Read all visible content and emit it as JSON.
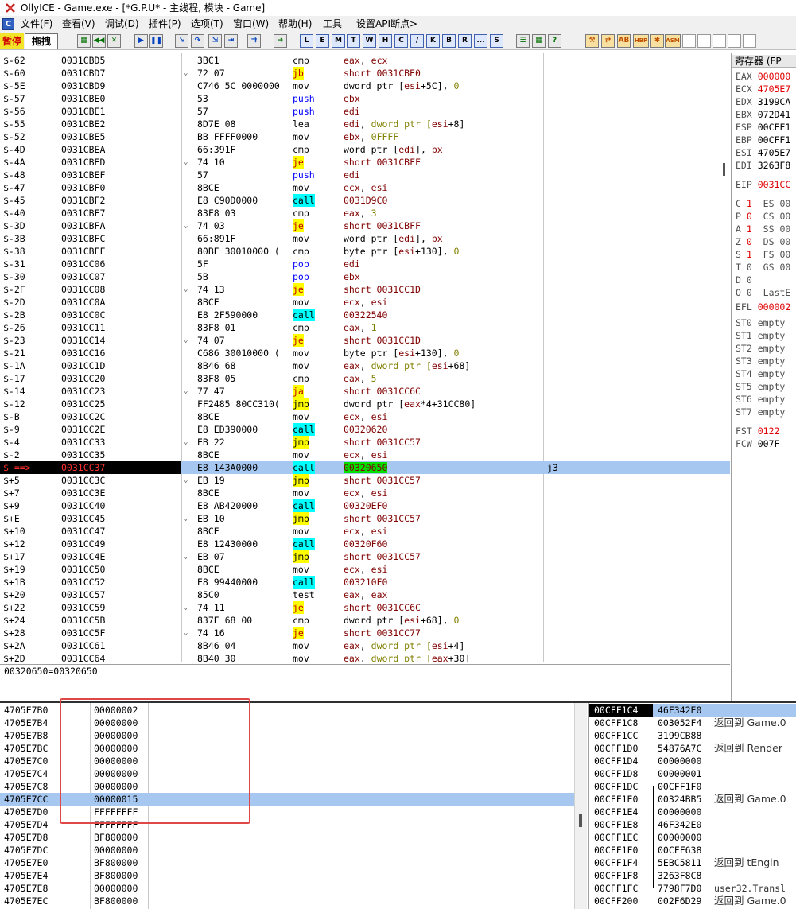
{
  "title": "OllyICE - Game.exe - [*G.P.U* - 主线程, 模块 - Game]",
  "menu": [
    "文件(F)",
    "查看(V)",
    "调试(D)",
    "插件(P)",
    "选项(T)",
    "窗口(W)",
    "帮助(H)",
    "工具",
    "设置API断点>"
  ],
  "toolbar": {
    "pause": "暂停",
    "drag": "拖拽",
    "letters": [
      "L",
      "E",
      "M",
      "T",
      "W",
      "H",
      "C",
      "/",
      "K",
      "B",
      "R",
      "...",
      "S"
    ],
    "extra": [
      "HBP",
      "ASM"
    ]
  },
  "cpu_rows": [
    {
      "label": "$-62",
      "addr": "0031CBD5",
      "hex": "3BC1",
      "mn": "cmp",
      "ops": "eax, ecx"
    },
    {
      "label": "$-60",
      "addr": "0031CBD7",
      "hex": "72 07",
      "mn": "jb",
      "ops": "short 0031CBE0",
      "arrow": "⌄"
    },
    {
      "label": "$-5E",
      "addr": "0031CBD9",
      "hex": "C746 5C 0000000",
      "mn": "mov",
      "ops": "dword ptr [esi+5C], 0"
    },
    {
      "label": "$-57",
      "addr": "0031CBE0",
      "hex": "53",
      "mn": "push",
      "ops": "ebx"
    },
    {
      "label": "$-56",
      "addr": "0031CBE1",
      "hex": "57",
      "mn": "push",
      "ops": "edi"
    },
    {
      "label": "$-55",
      "addr": "0031CBE2",
      "hex": "8D7E 08",
      "mn": "lea",
      "ops": "edi, dword ptr [esi+8]"
    },
    {
      "label": "$-52",
      "addr": "0031CBE5",
      "hex": "BB FFFF0000",
      "mn": "mov",
      "ops": "ebx, 0FFFF"
    },
    {
      "label": "$-4D",
      "addr": "0031CBEA",
      "hex": "66:391F",
      "mn": "cmp",
      "ops": "word ptr [edi], bx"
    },
    {
      "label": "$-4A",
      "addr": "0031CBED",
      "hex": "74 10",
      "mn": "je",
      "ops": "short 0031CBFF",
      "arrow": "⌄"
    },
    {
      "label": "$-48",
      "addr": "0031CBEF",
      "hex": "57",
      "mn": "push",
      "ops": "edi"
    },
    {
      "label": "$-47",
      "addr": "0031CBF0",
      "hex": "8BCE",
      "mn": "mov",
      "ops": "ecx, esi"
    },
    {
      "label": "$-45",
      "addr": "0031CBF2",
      "hex": "E8 C90D0000",
      "mn": "call",
      "ops": "0031D9C0"
    },
    {
      "label": "$-40",
      "addr": "0031CBF7",
      "hex": "83F8 03",
      "mn": "cmp",
      "ops": "eax, 3"
    },
    {
      "label": "$-3D",
      "addr": "0031CBFA",
      "hex": "74 03",
      "mn": "je",
      "ops": "short 0031CBFF",
      "arrow": "⌄"
    },
    {
      "label": "$-3B",
      "addr": "0031CBFC",
      "hex": "66:891F",
      "mn": "mov",
      "ops": "word ptr [edi], bx"
    },
    {
      "label": "$-38",
      "addr": "0031CBFF",
      "hex": "80BE 30010000 (",
      "mn": "cmp",
      "ops": "byte ptr [esi+130], 0"
    },
    {
      "label": "$-31",
      "addr": "0031CC06",
      "hex": "5F",
      "mn": "pop",
      "ops": "edi"
    },
    {
      "label": "$-30",
      "addr": "0031CC07",
      "hex": "5B",
      "mn": "pop",
      "ops": "ebx"
    },
    {
      "label": "$-2F",
      "addr": "0031CC08",
      "hex": "74 13",
      "mn": "je",
      "ops": "short 0031CC1D",
      "arrow": "⌄"
    },
    {
      "label": "$-2D",
      "addr": "0031CC0A",
      "hex": "8BCE",
      "mn": "mov",
      "ops": "ecx, esi"
    },
    {
      "label": "$-2B",
      "addr": "0031CC0C",
      "hex": "E8 2F590000",
      "mn": "call",
      "ops": "00322540"
    },
    {
      "label": "$-26",
      "addr": "0031CC11",
      "hex": "83F8 01",
      "mn": "cmp",
      "ops": "eax, 1"
    },
    {
      "label": "$-23",
      "addr": "0031CC14",
      "hex": "74 07",
      "mn": "je",
      "ops": "short 0031CC1D",
      "arrow": "⌄"
    },
    {
      "label": "$-21",
      "addr": "0031CC16",
      "hex": "C686 30010000 (",
      "mn": "mov",
      "ops": "byte ptr [esi+130], 0"
    },
    {
      "label": "$-1A",
      "addr": "0031CC1D",
      "hex": "8B46 68",
      "mn": "mov",
      "ops": "eax, dword ptr [esi+68]"
    },
    {
      "label": "$-17",
      "addr": "0031CC20",
      "hex": "83F8 05",
      "mn": "cmp",
      "ops": "eax, 5"
    },
    {
      "label": "$-14",
      "addr": "0031CC23",
      "hex": "77 47",
      "mn": "ja",
      "ops": "short 0031CC6C",
      "arrow": "⌄"
    },
    {
      "label": "$-12",
      "addr": "0031CC25",
      "hex": "FF2485 80CC310(",
      "mn": "jmp",
      "ops": "dword ptr [eax*4+31CC80]"
    },
    {
      "label": "$-B",
      "addr": "0031CC2C",
      "hex": "8BCE",
      "mn": "mov",
      "ops": "ecx, esi"
    },
    {
      "label": "$-9",
      "addr": "0031CC2E",
      "hex": "E8 ED390000",
      "mn": "call",
      "ops": "00320620"
    },
    {
      "label": "$-4",
      "addr": "0031CC33",
      "hex": "EB 22",
      "mn": "jmp",
      "ops": "short 0031CC57",
      "arrow": "⌄"
    },
    {
      "label": "$-2",
      "addr": "0031CC35",
      "hex": "8BCE",
      "mn": "mov",
      "ops": "ecx, esi"
    },
    {
      "label": "$ ==>",
      "addr": "0031CC37",
      "hex": "E8 143A0000",
      "mn": "call",
      "ops": "00320650",
      "comment": "j3",
      "current": true
    },
    {
      "label": "$+5",
      "addr": "0031CC3C",
      "hex": "EB 19",
      "mn": "jmp",
      "ops": "short 0031CC57",
      "arrow": "⌄"
    },
    {
      "label": "$+7",
      "addr": "0031CC3E",
      "hex": "8BCE",
      "mn": "mov",
      "ops": "ecx, esi"
    },
    {
      "label": "$+9",
      "addr": "0031CC40",
      "hex": "E8 AB420000",
      "mn": "call",
      "ops": "00320EF0"
    },
    {
      "label": "$+E",
      "addr": "0031CC45",
      "hex": "EB 10",
      "mn": "jmp",
      "ops": "short 0031CC57",
      "arrow": "⌄"
    },
    {
      "label": "$+10",
      "addr": "0031CC47",
      "hex": "8BCE",
      "mn": "mov",
      "ops": "ecx, esi"
    },
    {
      "label": "$+12",
      "addr": "0031CC49",
      "hex": "E8 12430000",
      "mn": "call",
      "ops": "00320F60"
    },
    {
      "label": "$+17",
      "addr": "0031CC4E",
      "hex": "EB 07",
      "mn": "jmp",
      "ops": "short 0031CC57",
      "arrow": "⌄"
    },
    {
      "label": "$+19",
      "addr": "0031CC50",
      "hex": "8BCE",
      "mn": "mov",
      "ops": "ecx, esi"
    },
    {
      "label": "$+1B",
      "addr": "0031CC52",
      "hex": "E8 99440000",
      "mn": "call",
      "ops": "003210F0"
    },
    {
      "label": "$+20",
      "addr": "0031CC57",
      "hex": "85C0",
      "mn": "test",
      "ops": "eax, eax"
    },
    {
      "label": "$+22",
      "addr": "0031CC59",
      "hex": "74 11",
      "mn": "je",
      "ops": "short 0031CC6C",
      "arrow": "⌄"
    },
    {
      "label": "$+24",
      "addr": "0031CC5B",
      "hex": "837E 68 00",
      "mn": "cmp",
      "ops": "dword ptr [esi+68], 0"
    },
    {
      "label": "$+28",
      "addr": "0031CC5F",
      "hex": "74 16",
      "mn": "je",
      "ops": "short 0031CC77",
      "arrow": "⌄"
    },
    {
      "label": "$+2A",
      "addr": "0031CC61",
      "hex": "8B46 04",
      "mn": "mov",
      "ops": "eax, dword ptr [esi+4]"
    },
    {
      "label": "$+2D",
      "addr": "0031CC64",
      "hex": "8B40 30",
      "mn": "mov",
      "ops": "eax, dword ptr [eax+30]"
    }
  ],
  "info_line": "00320650=00320650",
  "registers": {
    "header": "寄存器 (FP",
    "gp": [
      {
        "name": "EAX",
        "value": "000000",
        "changed": true
      },
      {
        "name": "ECX",
        "value": "4705E7",
        "changed": true
      },
      {
        "name": "EDX",
        "value": "3199CA",
        "changed": false
      },
      {
        "name": "EBX",
        "value": "072D41",
        "changed": false
      },
      {
        "name": "ESP",
        "value": "00CFF1",
        "changed": false
      },
      {
        "name": "EBP",
        "value": "00CFF1",
        "changed": false
      },
      {
        "name": "ESI",
        "value": "4705E7",
        "changed": false
      },
      {
        "name": "EDI",
        "value": "3263F8",
        "changed": false
      }
    ],
    "eip": {
      "name": "EIP",
      "value": "0031CC"
    },
    "flags": [
      {
        "f": "C",
        "v": "1",
        "seg": "ES 00",
        "hi": true
      },
      {
        "f": "P",
        "v": "0",
        "seg": "CS 00",
        "hi": true
      },
      {
        "f": "A",
        "v": "1",
        "seg": "SS 00",
        "hi": true
      },
      {
        "f": "Z",
        "v": "0",
        "seg": "DS 00",
        "hi": true
      },
      {
        "f": "S",
        "v": "1",
        "seg": "FS 00",
        "hi": true
      },
      {
        "f": "T",
        "v": "0",
        "seg": "GS 00",
        "hi": false
      },
      {
        "f": "D",
        "v": "0",
        "seg": "",
        "hi": false
      },
      {
        "f": "O",
        "v": "0",
        "seg": "LastE",
        "hi": false
      }
    ],
    "efl": {
      "name": "EFL",
      "value": "000002"
    },
    "fpu": [
      "ST0 empty",
      "ST1 empty",
      "ST2 empty",
      "ST3 empty",
      "ST4 empty",
      "ST5 empty",
      "ST6 empty",
      "ST7 empty"
    ],
    "fst": {
      "name": "FST",
      "value": "0122"
    },
    "fcw": {
      "name": "FCW",
      "value": "007F"
    }
  },
  "dump_rows": [
    {
      "addr": "4705E7B0",
      "val": "00000002"
    },
    {
      "addr": "4705E7B4",
      "val": "00000000"
    },
    {
      "addr": "4705E7B8",
      "val": "00000000"
    },
    {
      "addr": "4705E7BC",
      "val": "00000000"
    },
    {
      "addr": "4705E7C0",
      "val": "00000000"
    },
    {
      "addr": "4705E7C4",
      "val": "00000000"
    },
    {
      "addr": "4705E7C8",
      "val": "00000000"
    },
    {
      "addr": "4705E7CC",
      "val": "00000015",
      "selected": true
    },
    {
      "addr": "4705E7D0",
      "val": "FFFFFFFF"
    },
    {
      "addr": "4705E7D4",
      "val": "FFFFFFFF"
    },
    {
      "addr": "4705E7D8",
      "val": "BF800000"
    },
    {
      "addr": "4705E7DC",
      "val": "00000000"
    },
    {
      "addr": "4705E7E0",
      "val": "BF800000"
    },
    {
      "addr": "4705E7E4",
      "val": "BF800000"
    },
    {
      "addr": "4705E7E8",
      "val": "00000000"
    },
    {
      "addr": "4705E7EC",
      "val": "BF800000"
    }
  ],
  "stack_rows": [
    {
      "addr": "00CFF1C4",
      "val": "46F342E0",
      "comment": "",
      "top": true
    },
    {
      "addr": "00CFF1C8",
      "val": "003052F4",
      "comment": "返回到 Game.0"
    },
    {
      "addr": "00CFF1CC",
      "val": "3199CB88",
      "comment": ""
    },
    {
      "addr": "00CFF1D0",
      "val": "54876A7C",
      "comment": "返回到 Render"
    },
    {
      "addr": "00CFF1D4",
      "val": "00000000",
      "comment": ""
    },
    {
      "addr": "00CFF1D8",
      "val": "00000001",
      "comment": ""
    },
    {
      "addr": "00CFF1DC",
      "val": "00CFF1F0",
      "comment": ""
    },
    {
      "addr": "00CFF1E0",
      "val": "00324BB5",
      "comment": "返回到 Game.0"
    },
    {
      "addr": "00CFF1E4",
      "val": "00000000",
      "comment": ""
    },
    {
      "addr": "00CFF1E8",
      "val": "46F342E0",
      "comment": ""
    },
    {
      "addr": "00CFF1EC",
      "val": "00000000",
      "comment": ""
    },
    {
      "addr": "00CFF1F0",
      "val": "00CFF638",
      "comment": ""
    },
    {
      "addr": "00CFF1F4",
      "val": "5EBC5811",
      "comment": "返回到 tEngin"
    },
    {
      "addr": "00CFF1F8",
      "val": "3263F8C8",
      "comment": ""
    },
    {
      "addr": "00CFF1FC",
      "val": "7798F7D0",
      "comment": "user32.Transl"
    },
    {
      "addr": "00CFF200",
      "val": "002F6D29",
      "comment": "返回到 Game.0"
    }
  ]
}
